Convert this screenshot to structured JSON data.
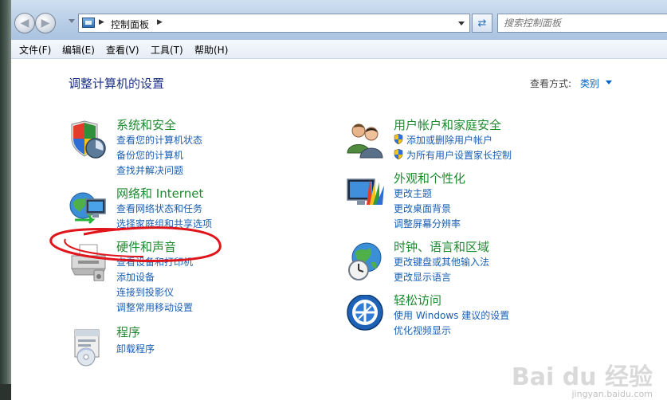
{
  "address": {
    "crumb": "控制面板"
  },
  "search": {
    "placeholder": "搜索控制面板"
  },
  "menu": [
    "文件(F)",
    "编辑(E)",
    "查看(V)",
    "工具(T)",
    "帮助(H)"
  ],
  "page": {
    "title": "调整计算机的设置",
    "view_by_label": "查看方式:",
    "view_by_value": "类别"
  },
  "categories": {
    "system_security": {
      "title": "系统和安全",
      "links": [
        "查看您的计算机状态",
        "备份您的计算机",
        "查找并解决问题"
      ]
    },
    "network": {
      "title": "网络和 Internet",
      "links": [
        "查看网络状态和任务",
        "选择家庭组和共享选项"
      ]
    },
    "hardware_sound": {
      "title": "硬件和声音",
      "links": [
        "查看设备和打印机",
        "添加设备",
        "连接到投影仪",
        "调整常用移动设置"
      ]
    },
    "programs": {
      "title": "程序",
      "links": [
        "卸载程序"
      ]
    },
    "user_accounts": {
      "title": "用户帐户和家庭安全",
      "links": [
        "添加或删除用户帐户",
        "为所有用户设置家长控制"
      ]
    },
    "appearance": {
      "title": "外观和个性化",
      "links": [
        "更改主题",
        "更改桌面背景",
        "调整屏幕分辨率"
      ]
    },
    "clock_region": {
      "title": "时钟、语言和区域",
      "links": [
        "更改键盘或其他输入法",
        "更改显示语言"
      ]
    },
    "ease_access": {
      "title": "轻松访问",
      "links": [
        "使用 Windows 建议的设置",
        "优化视频显示"
      ]
    }
  },
  "watermark": {
    "brand": "Bai du 经验",
    "url": "jingyan.baidu.com"
  }
}
